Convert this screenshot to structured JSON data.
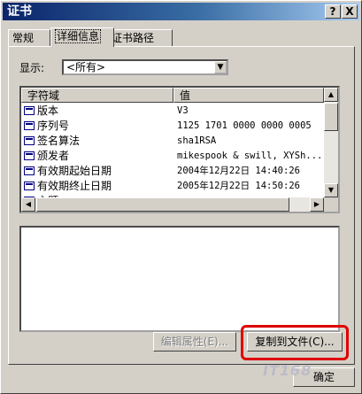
{
  "window": {
    "title": "证书",
    "help_label": "?",
    "close_label": "X"
  },
  "tabs": [
    {
      "label": "常规",
      "active": false
    },
    {
      "label": "详细信息",
      "active": true
    },
    {
      "label": "证书路径",
      "active": false
    }
  ],
  "show": {
    "label": "显示:",
    "selected": "<所有>"
  },
  "list": {
    "columns": [
      "字符域",
      "值"
    ],
    "rows": [
      {
        "field": "版本",
        "value": "V3"
      },
      {
        "field": "序列号",
        "value": "1125 1701 0000 0000 0005"
      },
      {
        "field": "签名算法",
        "value": "sha1RSA"
      },
      {
        "field": "颁发者",
        "value": "mikespook & swill, XYSh..."
      },
      {
        "field": "有效期起始日期",
        "value": "2004年12月22日 14:40:26"
      },
      {
        "field": "有效期终止日期",
        "value": "2005年12月22日 14:50:26"
      },
      {
        "field": "主题",
        "value": ""
      }
    ]
  },
  "buttons": {
    "edit_properties": "编辑属性(E)...",
    "copy_to_file": "复制到文件(C)...",
    "ok": "确定"
  },
  "watermark": "IT168",
  "colors": {
    "title_bar": "#0a246a",
    "highlight": "#e00000",
    "face": "#d4d0c8"
  }
}
